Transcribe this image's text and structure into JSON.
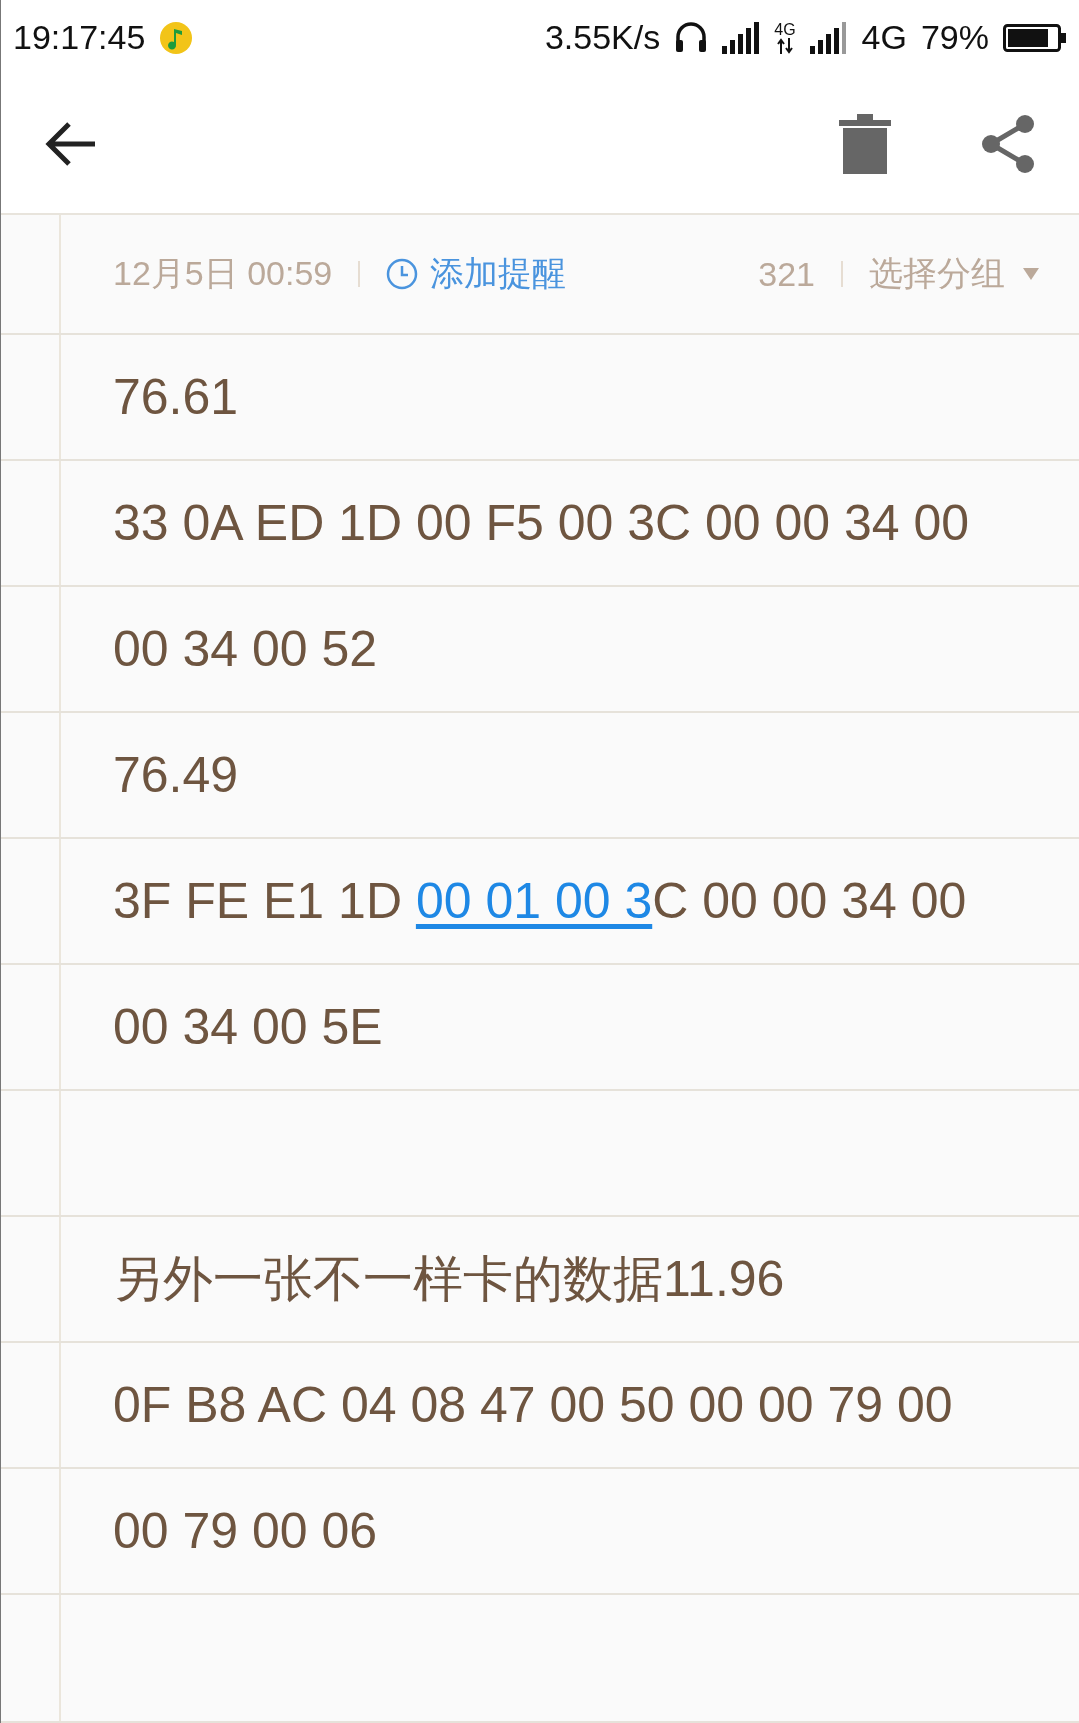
{
  "status_bar": {
    "time": "19:17:45",
    "speed": "3.55K/s",
    "network_small": "4G",
    "network": "4G",
    "battery": "79%"
  },
  "note_header": {
    "date": "12月5日 00:59",
    "reminder": "添加提醒",
    "count": "321",
    "group": "选择分组"
  },
  "lines": [
    {
      "kind": "text",
      "segments": [
        {
          "text": "76.61",
          "link": false
        }
      ]
    },
    {
      "kind": "text",
      "segments": [
        {
          "text": "33 0A ED 1D 00 F5 00 3C 00 00 34 00",
          "link": false
        }
      ]
    },
    {
      "kind": "text",
      "segments": [
        {
          "text": "00 34 00 52",
          "link": false
        }
      ]
    },
    {
      "kind": "text",
      "segments": [
        {
          "text": "76.49",
          "link": false
        }
      ]
    },
    {
      "kind": "text",
      "segments": [
        {
          "text": "3F FE E1 1D ",
          "link": false
        },
        {
          "text": "00 01 00 3",
          "link": true
        },
        {
          "text": "C 00 00 34 00",
          "link": false
        }
      ]
    },
    {
      "kind": "text",
      "segments": [
        {
          "text": "00 34 00 5E",
          "link": false
        }
      ]
    },
    {
      "kind": "blank"
    },
    {
      "kind": "text",
      "segments": [
        {
          "text": "另外一张不一样卡的数据11.96",
          "link": false
        }
      ]
    },
    {
      "kind": "text",
      "segments": [
        {
          "text": "0F B8 AC 04 08 47 00 50 00 00 79 00",
          "link": false
        }
      ]
    },
    {
      "kind": "text",
      "segments": [
        {
          "text": "00 79 00 06",
          "link": false
        }
      ]
    },
    {
      "kind": "blank"
    }
  ]
}
